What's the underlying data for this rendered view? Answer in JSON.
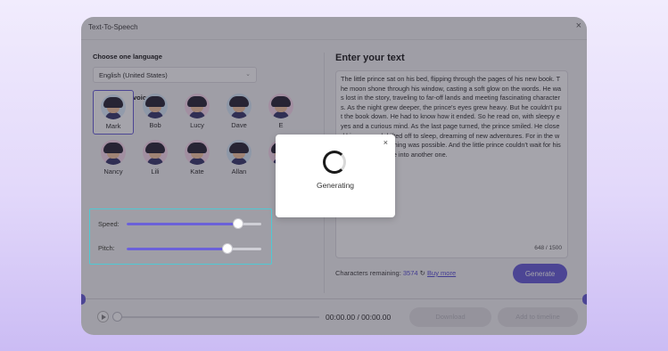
{
  "window": {
    "title": "Text-To-Speech",
    "close_icon": "×"
  },
  "language": {
    "label": "Choose one language",
    "selected": "English (United States)"
  },
  "voices": {
    "label": "Choose one voice",
    "selected": "Mark",
    "items": [
      {
        "name": "Mark",
        "color": "#dff0ff"
      },
      {
        "name": "Bob",
        "color": "#d9ecfb"
      },
      {
        "name": "Lucy",
        "color": "#fbdcef"
      },
      {
        "name": "Dave",
        "color": "#d9ecfb"
      },
      {
        "name": "E",
        "color": "#fbdcef"
      },
      {
        "name": "Nancy",
        "color": "#fbdcef"
      },
      {
        "name": "Lili",
        "color": "#fbdcef"
      },
      {
        "name": "Kate",
        "color": "#fbdcef"
      },
      {
        "name": "Allan",
        "color": "#d9ecfb"
      },
      {
        "name": "J",
        "color": "#fbdcef"
      }
    ]
  },
  "sliders": {
    "speed": {
      "label": "Speed:",
      "value": 0.83
    },
    "pitch": {
      "label": "Pitch:",
      "value": 0.75
    }
  },
  "editor": {
    "heading": "Enter your text",
    "text": "The little prince sat on his bed, flipping through the pages of his new book. The moon shone through his window, casting a soft glow on the words. He was lost in the story, traveling to far-off lands and meeting fascinating characters. As the night grew deeper, the prince's eyes grew heavy. But he couldn't put the book down. He had to know how it ended. So he read on, with sleepy eyes and a curious mind. As the last page turned, the prince smiled. He closed his eyes and drifted off to sleep, dreaming of new adventures. For in the world of books, anything was possible. And the little prince couldn't wait for his next chance to dive into another one.",
    "char_count": "648 / 1500"
  },
  "footer": {
    "remaining_label": "Characters remaining:",
    "remaining_value": "3574",
    "buy_more": "Buy more",
    "generate": "Generate"
  },
  "playback": {
    "time": "00:00.00 / 00:00.00",
    "download": "Download",
    "add_to_timeline": "Add to timeline"
  },
  "modal": {
    "status": "Generating",
    "close_icon": "×"
  },
  "colors": {
    "accent": "#6b61d9",
    "highlight_border": "#4fc9d4"
  }
}
